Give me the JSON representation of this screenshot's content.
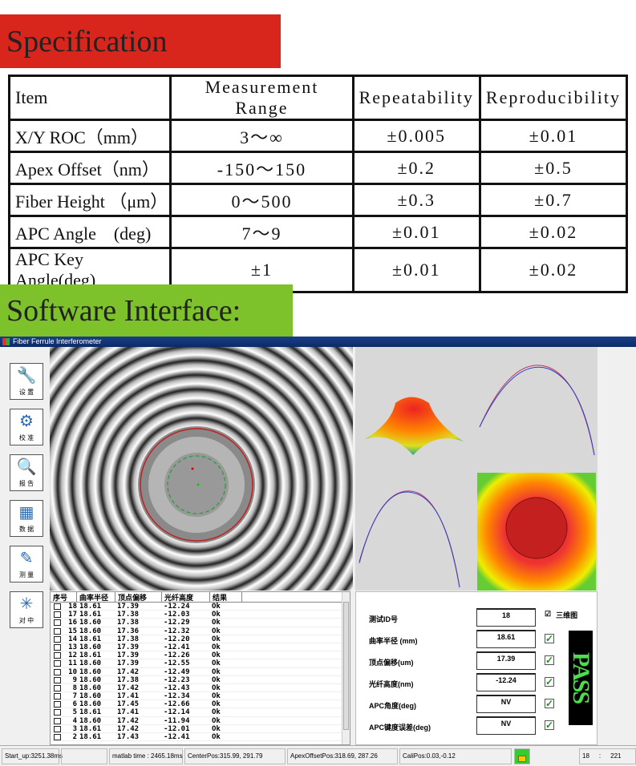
{
  "spec_title": "Specification",
  "spec_table": {
    "headers": [
      "Item",
      "Measurement Range",
      "Repeatability",
      "Reproducibility"
    ],
    "rows": [
      [
        "X/Y ROC（mm）",
        "3～∞",
        "±0.005",
        "±0.01"
      ],
      [
        "Apex Offset（nm）",
        "-150～150",
        "±0.2",
        "±0.5"
      ],
      [
        "Fiber Height （μm）",
        "0～500",
        "±0.3",
        "±0.7"
      ],
      [
        "APC Angle　(deg)",
        "7～9",
        "±0.01",
        "±0.02"
      ],
      [
        "APC Key Angle(deg)",
        "±1",
        "±0.01",
        "±0.02"
      ]
    ]
  },
  "software_title": "Software Interface:",
  "window_title": "Fiber Ferrule Interferometer",
  "toolbar": [
    {
      "label": "设 置",
      "icon": "wrench-icon"
    },
    {
      "label": "校 准",
      "icon": "gears-icon"
    },
    {
      "label": "报 告",
      "icon": "magnifier-report-icon"
    },
    {
      "label": "数 据",
      "icon": "spreadsheet-icon"
    },
    {
      "label": "测 量",
      "icon": "pen-ruler-icon"
    },
    {
      "label": "对 中",
      "icon": "spinner-icon"
    }
  ],
  "grid": {
    "headers": [
      "序号",
      "曲率半径",
      "顶点偏移",
      "光纤高度",
      "结果"
    ],
    "rows": [
      [
        "18",
        "18.61",
        "17.39",
        "-12.24",
        "Ok"
      ],
      [
        "17",
        "18.61",
        "17.38",
        "-12.03",
        "Ok"
      ],
      [
        "16",
        "18.60",
        "17.38",
        "-12.29",
        "Ok"
      ],
      [
        "15",
        "18.60",
        "17.36",
        "-12.32",
        "Ok"
      ],
      [
        "14",
        "18.61",
        "17.38",
        "-12.20",
        "Ok"
      ],
      [
        "13",
        "18.60",
        "17.39",
        "-12.41",
        "Ok"
      ],
      [
        "12",
        "18.61",
        "17.39",
        "-12.26",
        "Ok"
      ],
      [
        "11",
        "18.60",
        "17.39",
        "-12.55",
        "Ok"
      ],
      [
        "10",
        "18.60",
        "17.42",
        "-12.49",
        "Ok"
      ],
      [
        "9",
        "18.60",
        "17.38",
        "-12.23",
        "Ok"
      ],
      [
        "8",
        "18.60",
        "17.42",
        "-12.43",
        "Ok"
      ],
      [
        "7",
        "18.60",
        "17.41",
        "-12.34",
        "Ok"
      ],
      [
        "6",
        "18.60",
        "17.45",
        "-12.66",
        "Ok"
      ],
      [
        "5",
        "18.61",
        "17.41",
        "-12.14",
        "Ok"
      ],
      [
        "4",
        "18.60",
        "17.42",
        "-11.94",
        "Ok"
      ],
      [
        "3",
        "18.61",
        "17.42",
        "-12.01",
        "Ok"
      ],
      [
        "2",
        "18.61",
        "17.43",
        "-12.41",
        "Ok"
      ]
    ]
  },
  "results": {
    "fields": [
      {
        "label": "测试ID号",
        "value": "18"
      },
      {
        "label": "曲率半径 (mm)",
        "value": "18.61"
      },
      {
        "label": "顶点偏移(um)",
        "value": "17.39"
      },
      {
        "label": "光纤高度(nm)",
        "value": "-12.24"
      },
      {
        "label": "APC角度(deg)",
        "value": "NV"
      },
      {
        "label": "APC键度误差(deg)",
        "value": "NV"
      }
    ],
    "view3d_label": "三维图",
    "view3d_checked": true,
    "verdict": "PASS",
    "verdict_color": "#4be04b"
  },
  "status": {
    "startup": "Start_up:3251.38ms",
    "matlab": "matlab time : 2465.18ms",
    "center": "CenterPos:315.99, 291.79",
    "apex": "ApexOffsetPos:318.69, 287.26",
    "cali": "CaliPos:0.03,-0.12",
    "count": "18",
    "sep": ":",
    "total": "221",
    "lock_icon": "unlock-icon"
  }
}
